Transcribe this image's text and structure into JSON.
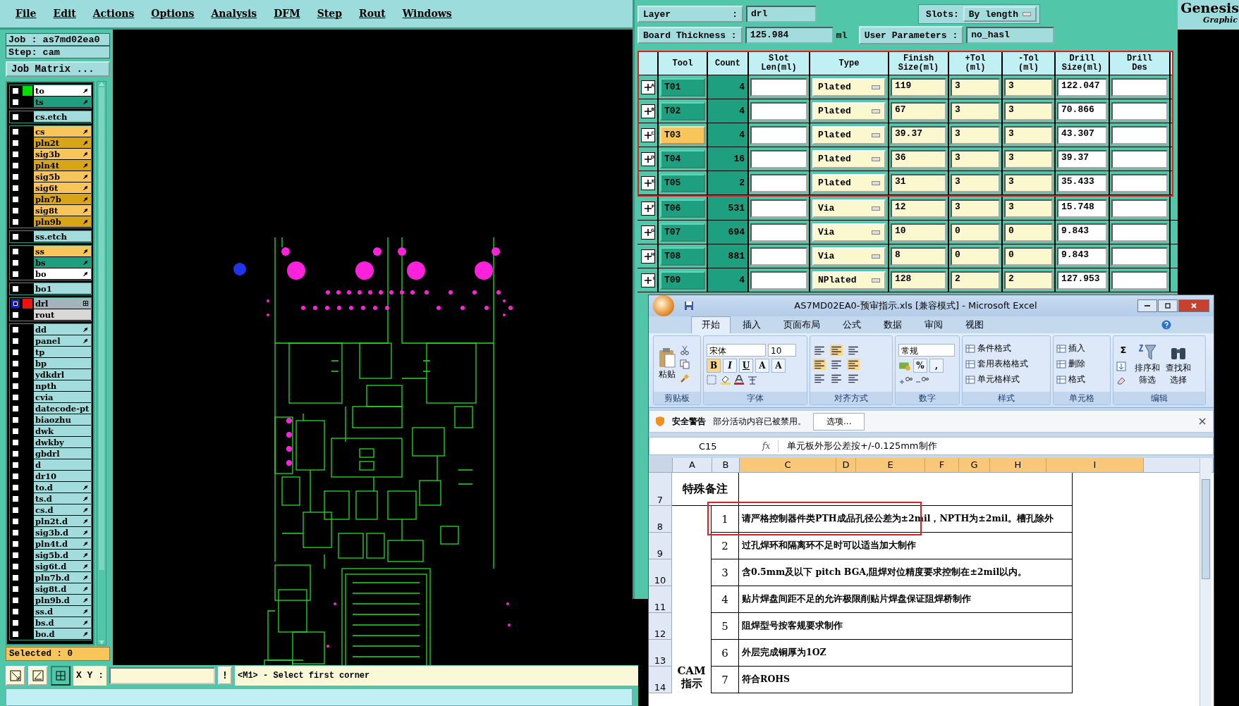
{
  "menu": [
    "File",
    "Edit",
    "Actions",
    "Options",
    "Analysis",
    "DFM",
    "Step",
    "Rout",
    "Windows"
  ],
  "job_panel": {
    "job": "Job : as7md02ea0",
    "step": "Step: cam",
    "matrix_button": "Job Matrix ..."
  },
  "layer_groups": [
    [
      {
        "name": "to",
        "color": "#ffffff",
        "kind": "arrow",
        "active": false,
        "swatch": {
          "color": "#00dd00"
        }
      },
      {
        "name": "ts",
        "color": "#1ea080",
        "kind": "arrow",
        "active": false
      }
    ],
    [
      {
        "name": "cs.etch",
        "color": "#a2dcdc",
        "kind": "plain",
        "active": false
      }
    ],
    [
      {
        "name": "cs",
        "color": "#f8c55a",
        "kind": "arrow",
        "active": false
      },
      {
        "name": "pln2t",
        "color": "#d8a418",
        "kind": "arrow",
        "active": false
      },
      {
        "name": "sig3b",
        "color": "#f8c55a",
        "kind": "arrow",
        "active": false
      },
      {
        "name": "pln4t",
        "color": "#d8a418",
        "kind": "arrow",
        "active": false
      },
      {
        "name": "sig5b",
        "color": "#f8c55a",
        "kind": "arrow",
        "active": false
      },
      {
        "name": "sig6t",
        "color": "#f8c55a",
        "kind": "arrow",
        "active": false
      },
      {
        "name": "pln7b",
        "color": "#d8a418",
        "kind": "arrow",
        "active": false
      },
      {
        "name": "sig8t",
        "color": "#f8c55a",
        "kind": "arrow",
        "active": false
      },
      {
        "name": "pln9b",
        "color": "#d8a418",
        "kind": "arrow",
        "active": false
      }
    ],
    [
      {
        "name": "ss.etch",
        "color": "#a2dcdc",
        "kind": "plain",
        "active": false
      }
    ],
    [
      {
        "name": "ss",
        "color": "#f8c55a",
        "kind": "arrow",
        "active": false
      },
      {
        "name": "bs",
        "color": "#1ea080",
        "kind": "arrow",
        "active": false
      },
      {
        "name": "bo",
        "color": "#ffffff",
        "kind": "arrow",
        "active": false
      }
    ],
    [
      {
        "name": "bo1",
        "color": "#a2dcdc",
        "kind": "plain",
        "active": false
      }
    ],
    [
      {
        "name": "drl",
        "color": "#a4b4bc",
        "kind": "box",
        "active": true,
        "swatch": {
          "color": "#ee1111"
        }
      },
      {
        "name": "rout",
        "color": "#d8d8d8",
        "kind": "plain",
        "active": false
      }
    ],
    [
      {
        "name": "dd",
        "color": "#a2dcdc",
        "kind": "arrow",
        "active": false
      },
      {
        "name": "panel",
        "color": "#a2dcdc",
        "kind": "arrow",
        "active": false
      },
      {
        "name": "tp",
        "color": "#a2dcdc",
        "kind": "plain",
        "active": false
      },
      {
        "name": "bp",
        "color": "#a2dcdc",
        "kind": "plain",
        "active": false
      },
      {
        "name": "ydkdrl",
        "color": "#a2dcdc",
        "kind": "plain",
        "active": false
      },
      {
        "name": "npth",
        "color": "#a2dcdc",
        "kind": "plain",
        "active": false
      },
      {
        "name": "cvia",
        "color": "#a2dcdc",
        "kind": "plain",
        "active": false
      },
      {
        "name": "datecode-pt",
        "color": "#a2dcdc",
        "kind": "plain",
        "active": false
      },
      {
        "name": "biaozhu",
        "color": "#a2dcdc",
        "kind": "plain",
        "active": false
      },
      {
        "name": "dwk",
        "color": "#a2dcdc",
        "kind": "plain",
        "active": false
      },
      {
        "name": "dwkby",
        "color": "#a2dcdc",
        "kind": "plain",
        "active": false
      },
      {
        "name": "gbdrl",
        "color": "#a2dcdc",
        "kind": "plain",
        "active": false
      },
      {
        "name": "d",
        "color": "#a2dcdc",
        "kind": "plain",
        "active": false
      },
      {
        "name": "dr10",
        "color": "#a2dcdc",
        "kind": "plain",
        "active": false
      },
      {
        "name": "to.d",
        "color": "#a2dcdc",
        "kind": "arrow",
        "active": false
      },
      {
        "name": "ts.d",
        "color": "#a2dcdc",
        "kind": "arrow",
        "active": false
      },
      {
        "name": "cs.d",
        "color": "#a2dcdc",
        "kind": "arrow",
        "active": false
      },
      {
        "name": "pln2t.d",
        "color": "#a2dcdc",
        "kind": "arrow",
        "active": false
      },
      {
        "name": "sig3b.d",
        "color": "#a2dcdc",
        "kind": "arrow",
        "active": false
      },
      {
        "name": "pln4t.d",
        "color": "#a2dcdc",
        "kind": "arrow",
        "active": false
      },
      {
        "name": "sig5b.d",
        "color": "#a2dcdc",
        "kind": "arrow",
        "active": false
      },
      {
        "name": "sig6t.d",
        "color": "#a2dcdc",
        "kind": "arrow",
        "active": false
      },
      {
        "name": "pln7b.d",
        "color": "#a2dcdc",
        "kind": "arrow",
        "active": false
      },
      {
        "name": "sig8t.d",
        "color": "#a2dcdc",
        "kind": "arrow",
        "active": false
      },
      {
        "name": "pln9b.d",
        "color": "#a2dcdc",
        "kind": "arrow",
        "active": false
      },
      {
        "name": "ss.d",
        "color": "#a2dcdc",
        "kind": "arrow",
        "active": false
      },
      {
        "name": "bs.d",
        "color": "#a2dcdc",
        "kind": "arrow",
        "active": false
      },
      {
        "name": "bo.d",
        "color": "#a2dcdc",
        "kind": "arrow",
        "active": false
      }
    ]
  ],
  "selected_count": "Selected : 0",
  "bottom_bar": {
    "xy_label": "X Y :",
    "prompt_button": "!",
    "message": "<M1> - Select first corner"
  },
  "drill_panel": {
    "layer_label": "Layer",
    "layer_colon": ":",
    "layer_value": "drl",
    "slots_label": "Slots:",
    "slots_value": "By length",
    "thickness_label": "Board Thickness :",
    "thickness_value": "125.984",
    "thickness_unit": "ml",
    "user_params_button": "User Parameters :",
    "user_params_value": "no_hasl",
    "columns": [
      "Tool",
      "Count",
      "Slot\nLen(ml)",
      "Type",
      "Finish\nSize(ml)",
      "+Tol\n(ml)",
      "-Tol\n(ml)",
      "Drill\nSize(ml)",
      "Drill\nDes"
    ],
    "rows": [
      {
        "key": "A",
        "tool": "T01",
        "count": "4",
        "type": "Plated",
        "finish": "119",
        "plus_tol": "3",
        "minus_tol": "3",
        "drill_size": "122.047",
        "selected": false,
        "highlighted": true
      },
      {
        "key": "B",
        "tool": "T02",
        "count": "4",
        "type": "Plated",
        "finish": "67",
        "plus_tol": "3",
        "minus_tol": "3",
        "drill_size": "70.866",
        "selected": false,
        "highlighted": true
      },
      {
        "key": "C",
        "tool": "T03",
        "count": "4",
        "type": "Plated",
        "finish": "39.37",
        "plus_tol": "3",
        "minus_tol": "3",
        "drill_size": "43.307",
        "selected": true,
        "highlighted": true
      },
      {
        "key": "D",
        "tool": "T04",
        "count": "16",
        "type": "Plated",
        "finish": "36",
        "plus_tol": "3",
        "minus_tol": "3",
        "drill_size": "39.37",
        "selected": false,
        "highlighted": true
      },
      {
        "key": "E",
        "tool": "T05",
        "count": "2",
        "type": "Plated",
        "finish": "31",
        "plus_tol": "3",
        "minus_tol": "3",
        "drill_size": "35.433",
        "selected": false,
        "highlighted": true
      },
      {
        "key": "F",
        "tool": "T06",
        "count": "531",
        "type": "Via",
        "finish": "12",
        "plus_tol": "3",
        "minus_tol": "3",
        "drill_size": "15.748",
        "selected": false,
        "highlighted": false
      },
      {
        "key": "G",
        "tool": "T07",
        "count": "694",
        "type": "Via",
        "finish": "10",
        "plus_tol": "0",
        "minus_tol": "0",
        "drill_size": "9.843",
        "selected": false,
        "highlighted": false
      },
      {
        "key": "H",
        "tool": "T08",
        "count": "881",
        "type": "Via",
        "finish": "8",
        "plus_tol": "0",
        "minus_tol": "0",
        "drill_size": "9.843",
        "selected": false,
        "highlighted": false
      },
      {
        "key": "I",
        "tool": "T09",
        "count": "4",
        "type": "NPlated",
        "finish": "128",
        "plus_tol": "2",
        "minus_tol": "2",
        "drill_size": "127.953",
        "selected": false,
        "highlighted": false
      }
    ]
  },
  "brand": {
    "name": "Genesis",
    "tagline": "Graphic"
  },
  "excel": {
    "title": "AS7MD02EA0-预审指示.xls  [兼容模式] - Microsoft Excel",
    "tabs": [
      {
        "label": "开始",
        "selected": true
      },
      {
        "label": "插入",
        "selected": false
      },
      {
        "label": "页面布局",
        "selected": false
      },
      {
        "label": "公式",
        "selected": false
      },
      {
        "label": "数据",
        "selected": false
      },
      {
        "label": "审阅",
        "selected": false
      },
      {
        "label": "视图",
        "selected": false
      }
    ],
    "ribbon": [
      {
        "kind": "clipboard",
        "label": "剪贴板",
        "big_button": "粘贴"
      },
      {
        "kind": "font",
        "label": "字体",
        "font": "宋体",
        "size": "10",
        "buttons": [
          "B",
          "I",
          "U",
          "A",
          "A"
        ]
      },
      {
        "kind": "align",
        "label": "对齐方式"
      },
      {
        "kind": "number",
        "label": "数字",
        "format": "常规",
        "buttons": [
          "%",
          ","
        ]
      },
      {
        "kind": "list",
        "label": "样式",
        "items": [
          "条件格式",
          "套用表格格式",
          "单元格样式"
        ]
      },
      {
        "kind": "list",
        "label": "单元格",
        "items": [
          "插入",
          "删除",
          "格式"
        ]
      },
      {
        "kind": "edit",
        "label": "编辑",
        "sigma": "Σ",
        "items": [
          "排序和筛选",
          "查找和选择"
        ]
      }
    ],
    "security": {
      "title": "安全警告",
      "message": "部分活动内容已被禁用。",
      "button": "选项..."
    },
    "formula_bar": {
      "cell": "C15",
      "fx": "fx",
      "value": "单元板外形公差按+/-0.125mm制作"
    },
    "columns": [
      {
        "label": "A",
        "selected": false
      },
      {
        "label": "B",
        "selected": false
      },
      {
        "label": "C",
        "selected": true
      },
      {
        "label": "D",
        "selected": true
      },
      {
        "label": "E",
        "selected": true
      },
      {
        "label": "F",
        "selected": true
      },
      {
        "label": "G",
        "selected": true
      },
      {
        "label": "H",
        "selected": true
      },
      {
        "label": "I",
        "selected": true
      }
    ],
    "heading_row": {
      "row": "7",
      "label": "特殊备注"
    },
    "section_label": "CAM 指示",
    "items": [
      {
        "row": "8",
        "no": "1",
        "text": "请严格控制器件类PTH成品孔径公差为±2mil，NPTH为±2mil。槽孔除外",
        "marked": true
      },
      {
        "row": "9",
        "no": "2",
        "text": "过孔焊环和隔离环不足时可以适当加大制作",
        "marked": false
      },
      {
        "row": "10",
        "no": "3",
        "text": "含0.5mm及以下 pitch BGA,阻焊对位精度要求控制在±2mil以内。",
        "marked": false
      },
      {
        "row": "11",
        "no": "4",
        "text": "贴片焊盘间距不足的允许极限削贴片焊盘保证阻焊桥制作",
        "marked": false
      },
      {
        "row": "12",
        "no": "5",
        "text": "阻焊型号按客规要求制作",
        "marked": false
      },
      {
        "row": "13",
        "no": "6",
        "text": "外层完成铜厚为1OZ",
        "marked": false
      },
      {
        "row": "14",
        "no": "7",
        "text": "符合ROHS",
        "marked": false
      }
    ]
  }
}
